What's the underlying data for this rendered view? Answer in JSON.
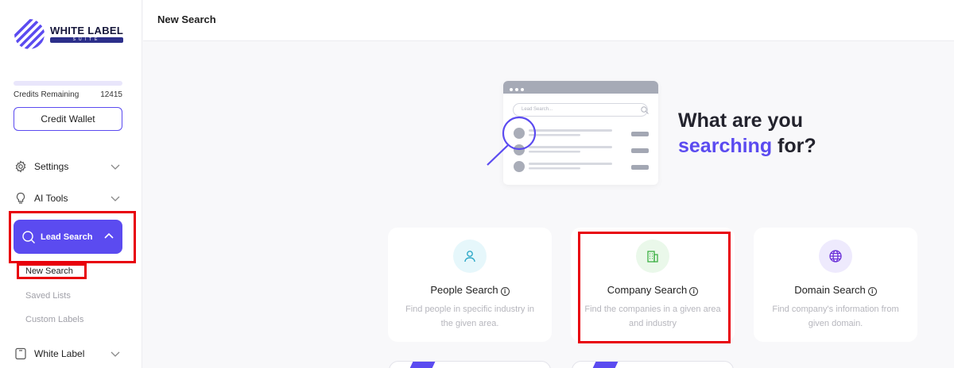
{
  "brand": {
    "name": "WHITE LABEL",
    "suite": "SUITE"
  },
  "credits": {
    "label": "Credits Remaining",
    "value": "12415",
    "wallet_button": "Credit Wallet"
  },
  "nav": {
    "settings": "Settings",
    "ai_tools": "AI Tools",
    "lead_search": "Lead Search",
    "sub_items": [
      "New Search",
      "Saved Lists",
      "Custom Labels"
    ],
    "white_label": "White Label"
  },
  "header": {
    "title": "New Search"
  },
  "hero": {
    "search_placeholder": "Lead Search...",
    "line1": "What are you",
    "accent": "searching",
    "line2_rest": " for?"
  },
  "cards": [
    {
      "title": "People Search",
      "desc": "Find people in specific industry in the given area.",
      "icon": "person-icon",
      "color": "#e6f7fb"
    },
    {
      "title": "Company Search",
      "desc": "Find the companies in a given area and industry",
      "icon": "building-icon",
      "color": "#eaf8ea"
    },
    {
      "title": "Domain Search",
      "desc": "Find company's information from given domain.",
      "icon": "globe-icon",
      "color": "#eeeafd"
    }
  ],
  "colors": {
    "accent": "#5b4bf0",
    "highlight": "#e8000b"
  }
}
